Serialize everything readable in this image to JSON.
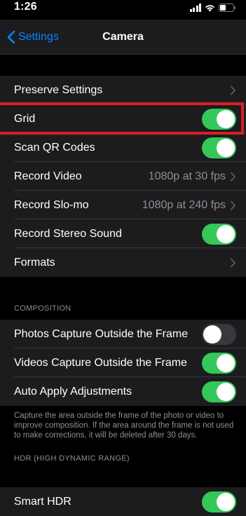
{
  "status": {
    "time": "1:26"
  },
  "nav": {
    "back_label": "Settings",
    "title": "Camera"
  },
  "group1": [
    {
      "label": "Preserve Settings",
      "kind": "chevron"
    },
    {
      "label": "Grid",
      "kind": "toggle",
      "on": true
    },
    {
      "label": "Scan QR Codes",
      "kind": "toggle",
      "on": true
    },
    {
      "label": "Record Video",
      "kind": "value",
      "value": "1080p at 30 fps"
    },
    {
      "label": "Record Slo-mo",
      "kind": "value",
      "value": "1080p at 240 fps"
    },
    {
      "label": "Record Stereo Sound",
      "kind": "toggle",
      "on": true
    },
    {
      "label": "Formats",
      "kind": "chevron"
    }
  ],
  "composition": {
    "header": "COMPOSITION",
    "rows": [
      {
        "label": "Photos Capture Outside the Frame",
        "kind": "toggle",
        "on": false
      },
      {
        "label": "Videos Capture Outside the Frame",
        "kind": "toggle",
        "on": true
      },
      {
        "label": "Auto Apply Adjustments",
        "kind": "toggle",
        "on": true
      }
    ],
    "footer": "Capture the area outside the frame of the photo or video to improve composition. If the area around the frame is not used to make corrections, it will be deleted after 30 days."
  },
  "hdr": {
    "header": "HDR (HIGH DYNAMIC RANGE)",
    "rows": [
      {
        "label": "Smart HDR",
        "kind": "toggle",
        "on": true
      }
    ]
  },
  "colors": {
    "accent": "#0a84ff",
    "toggle_on": "#34c759",
    "highlight": "#d91f26"
  }
}
